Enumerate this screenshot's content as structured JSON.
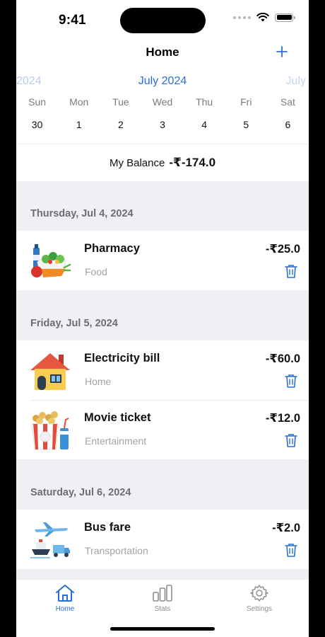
{
  "status_bar": {
    "time": "9:41"
  },
  "nav": {
    "title": "Home"
  },
  "calendar": {
    "prev_month": "2024",
    "current_month": "July 2024",
    "next_month": "July",
    "weekdays": [
      "Sun",
      "Mon",
      "Tue",
      "Wed",
      "Thu",
      "Fri",
      "Sat"
    ],
    "days": [
      "30",
      "1",
      "2",
      "3",
      "4",
      "5",
      "6"
    ]
  },
  "balance": {
    "label": "My Balance",
    "value": "-₹-174.0"
  },
  "sections": [
    {
      "date": "Thursday, Jul 4, 2024",
      "transactions": [
        {
          "name": "Pharmacy",
          "category": "Food",
          "amount": "-₹25.0",
          "icon": "food-groceries-icon"
        }
      ]
    },
    {
      "date": "Friday, Jul 5, 2024",
      "transactions": [
        {
          "name": "Electricity bill",
          "category": "Home",
          "amount": "-₹60.0",
          "icon": "house-icon"
        },
        {
          "name": "Movie ticket",
          "category": "Entertainment",
          "amount": "-₹12.0",
          "icon": "popcorn-icon"
        }
      ]
    },
    {
      "date": "Saturday, Jul 6, 2024",
      "transactions": [
        {
          "name": "Bus fare",
          "category": "Transportation",
          "amount": "-₹2.0",
          "icon": "transportation-icon"
        }
      ]
    }
  ],
  "tabs": [
    {
      "label": "Home",
      "icon": "house-outline-icon",
      "active": true
    },
    {
      "label": "Stats",
      "icon": "bar-chart-icon",
      "active": false
    },
    {
      "label": "Settings",
      "icon": "gear-icon",
      "active": false
    }
  ],
  "colors": {
    "accent": "#2a6fd6",
    "background": "#efeff4"
  }
}
